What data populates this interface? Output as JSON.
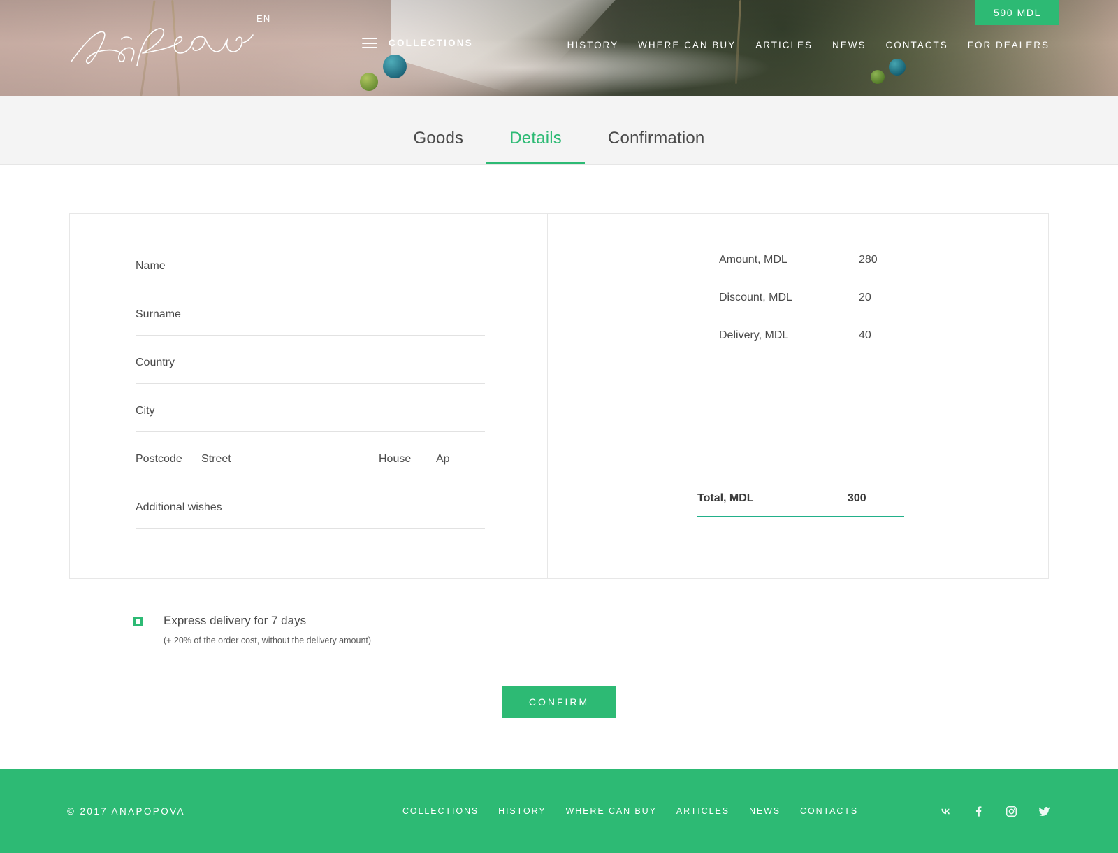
{
  "header": {
    "brand_name": "Ana Popova",
    "language": "EN",
    "collections_label": "COLLECTIONS",
    "cart_total": "590 MDL",
    "nav": [
      {
        "label": "HISTORY"
      },
      {
        "label": "WHERE CAN BUY"
      },
      {
        "label": "ARTICLES"
      },
      {
        "label": "NEWS"
      },
      {
        "label": "CONTACTS"
      },
      {
        "label": "FOR DEALERS"
      }
    ]
  },
  "tabs": [
    {
      "label": "Goods",
      "active": false
    },
    {
      "label": "Details",
      "active": true
    },
    {
      "label": "Confirmation",
      "active": false
    }
  ],
  "form": {
    "name": {
      "placeholder": "Name",
      "value": ""
    },
    "surname": {
      "placeholder": "Surname",
      "value": ""
    },
    "country": {
      "placeholder": "Country",
      "value": ""
    },
    "city": {
      "placeholder": "City",
      "value": ""
    },
    "postcode": {
      "placeholder": "Postcode",
      "value": ""
    },
    "street": {
      "placeholder": "Street",
      "value": ""
    },
    "house": {
      "placeholder": "House",
      "value": ""
    },
    "ap": {
      "placeholder": "Ap",
      "value": ""
    },
    "additional_wishes": {
      "placeholder": "Additional wishes",
      "value": ""
    }
  },
  "summary": {
    "rows": [
      {
        "label": "Amount, MDL",
        "value": "280"
      },
      {
        "label": "Discount, MDL",
        "value": "20"
      },
      {
        "label": "Delivery, MDL",
        "value": "40"
      }
    ],
    "total": {
      "label": "Total, MDL",
      "value": "300"
    }
  },
  "express": {
    "checked": true,
    "label": "Express delivery for 7 days",
    "note": "(+ 20% of the order cost, without the delivery amount)"
  },
  "confirm_button": {
    "label": "CONFIRM"
  },
  "footer": {
    "copyright": "© 2017  ANAPOPOVA",
    "nav": [
      {
        "label": "COLLECTIONS"
      },
      {
        "label": "HISTORY"
      },
      {
        "label": "WHERE CAN BUY"
      },
      {
        "label": "ARTICLES"
      },
      {
        "label": "NEWS"
      },
      {
        "label": "CONTACTS"
      }
    ],
    "socials": [
      {
        "name": "vk-icon"
      },
      {
        "name": "facebook-icon"
      },
      {
        "name": "instagram-icon"
      },
      {
        "name": "twitter-icon"
      }
    ]
  },
  "colors": {
    "accent_green": "#2dba74",
    "total_underline": "#22b08a",
    "tabs_bg": "#f4f4f4",
    "text": "#4a4a4a"
  }
}
